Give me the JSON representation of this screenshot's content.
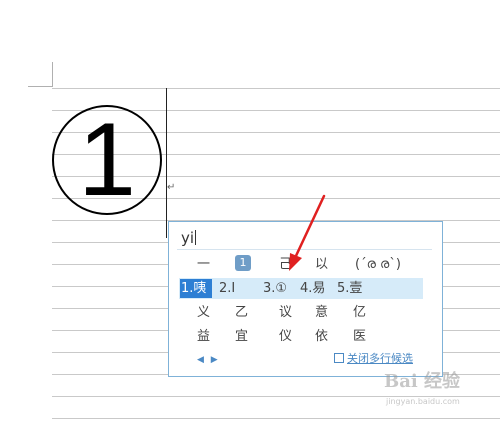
{
  "document": {
    "circled_digit": "1",
    "paragraph_mark": "↵"
  },
  "ime": {
    "input_text": "yi",
    "row1": {
      "c1": "一",
      "badge": "1",
      "c3": "己",
      "c4": "以",
      "c5": "(´ര ര`)"
    },
    "row2": {
      "c1": "1.咦",
      "c2": "2.Ⅰ",
      "c3": "3.①",
      "c4": "4.易",
      "c5": "5.壹"
    },
    "row3": {
      "c1": "义",
      "c2": "乙",
      "c3": "议",
      "c4": "意",
      "c5": "亿"
    },
    "row4": {
      "c1": "益",
      "c2": "宜",
      "c3": "仪",
      "c4": "依",
      "c5": "医"
    },
    "page_arrows": "◀ ▶",
    "close_multirow_label": "关闭多行候选"
  },
  "colors": {
    "popup_border": "#7fb2d8",
    "row_highlight": "#d6ebf9",
    "selected_bg": "#2d7fd4",
    "link": "#4b89c4",
    "arrow": "#e02020"
  },
  "watermark": {
    "logo": "Bai 经验",
    "url": "jingyan.baidu.com"
  }
}
